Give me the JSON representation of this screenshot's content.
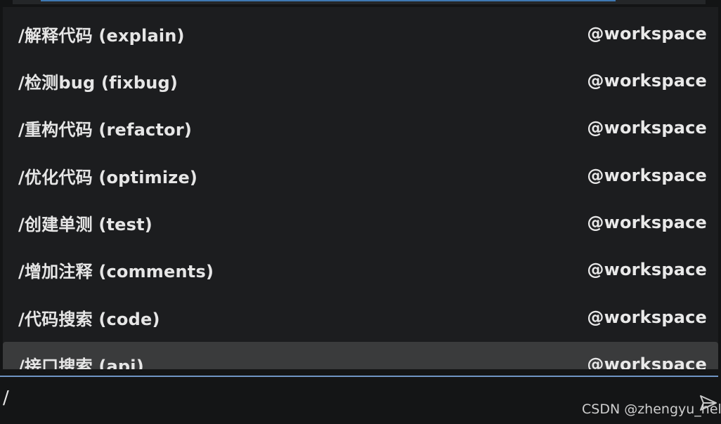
{
  "commands": [
    {
      "label": "/解释代码 (explain)",
      "scope": "@workspace",
      "selected": false
    },
    {
      "label": "/检测bug (fixbug)",
      "scope": "@workspace",
      "selected": false
    },
    {
      "label": "/重构代码 (refactor)",
      "scope": "@workspace",
      "selected": false
    },
    {
      "label": "/优化代码 (optimize)",
      "scope": "@workspace",
      "selected": false
    },
    {
      "label": "/创建单测 (test)",
      "scope": "@workspace",
      "selected": false
    },
    {
      "label": "/增加注释 (comments)",
      "scope": "@workspace",
      "selected": false
    },
    {
      "label": "/代码搜索 (code)",
      "scope": "@workspace",
      "selected": false
    },
    {
      "label": "/接口搜索 (api)",
      "scope": "@workspace",
      "selected": true
    }
  ],
  "input": {
    "value": "/"
  },
  "icons": {
    "send": "send-icon"
  },
  "watermark": "CSDN @zhengyu_hello",
  "colors": {
    "background": "#131415",
    "menu_background": "#1c1d1f",
    "selected_background": "#3a3b3c",
    "input_border": "#6f94c4",
    "accent_bar": "#3f79b3"
  }
}
